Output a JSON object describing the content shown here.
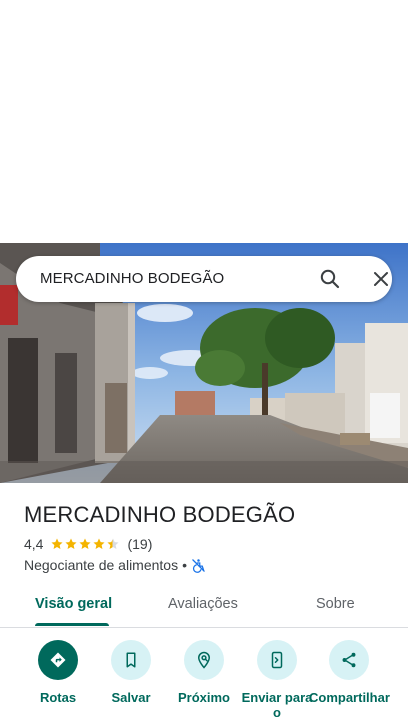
{
  "search": {
    "query": "MERCADINHO BODEGÃO"
  },
  "place": {
    "name": "MERCADINHO BODEGÃO",
    "rating": "4,4",
    "stars": 4.4,
    "review_count": "(19)",
    "category": "Negociante de alimentos",
    "separator": "•",
    "accessibility_icon": "wheelchair-not-accessible-icon"
  },
  "tabs": [
    {
      "label": "Visão geral",
      "active": true
    },
    {
      "label": "Avaliações",
      "active": false
    },
    {
      "label": "Sobre",
      "active": false
    }
  ],
  "actions": [
    {
      "label": "Rotas",
      "icon": "directions-icon"
    },
    {
      "label": "Salvar",
      "icon": "bookmark-icon"
    },
    {
      "label": "Próximo",
      "icon": "nearby-icon"
    },
    {
      "label": "Enviar para o",
      "icon": "send-to-phone-icon"
    },
    {
      "label": "Compartilhar",
      "icon": "share-icon"
    }
  ],
  "colors": {
    "accent": "#00695c",
    "action_bg": "#d7f2f5",
    "star": "#f4b400"
  }
}
